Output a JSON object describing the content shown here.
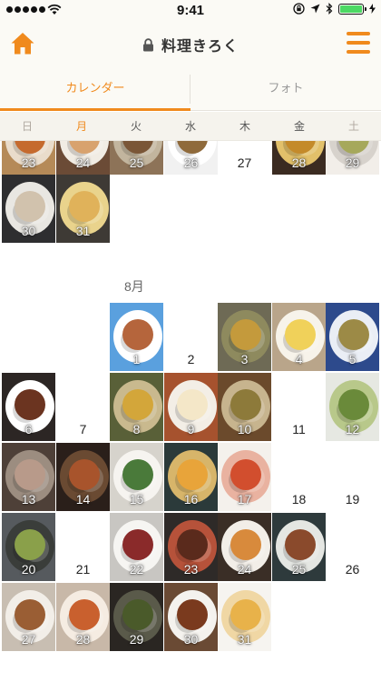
{
  "status_bar": {
    "time": "9:41"
  },
  "nav": {
    "title": "料理きろく"
  },
  "tabs": [
    {
      "label": "カレンダー",
      "active": true
    },
    {
      "label": "フォト",
      "active": false
    }
  ],
  "weekdays": [
    "日",
    "月",
    "火",
    "水",
    "木",
    "金",
    "土"
  ],
  "colors": {
    "accent": "#f08a1d",
    "background": "#fbfaf5",
    "battery": "#4cd964"
  },
  "calendar": {
    "prev_month_days": [
      {
        "day": "23",
        "photo": true,
        "bg": "#b58a58",
        "plate": "#e9dccb",
        "food": "#c56a2e"
      },
      {
        "day": "24",
        "photo": true,
        "bg": "#6b4b36",
        "plate": "#f1ece4",
        "food": "#d8a26e"
      },
      {
        "day": "25",
        "photo": true,
        "bg": "#8d7358",
        "plate": "#c2b59e",
        "food": "#7a5637"
      },
      {
        "day": "26",
        "photo": true,
        "bg": "#f1f1f1",
        "plate": "#ffffff",
        "food": "#8f6a3b"
      },
      {
        "day": "27",
        "photo": false
      },
      {
        "day": "28",
        "photo": true,
        "bg": "#3b2b21",
        "plate": "#e2c06a",
        "food": "#c48a2a"
      },
      {
        "day": "29",
        "photo": true,
        "bg": "#f2eee9",
        "plate": "#d7d2cc",
        "food": "#a6a85b"
      },
      {
        "day": "30",
        "photo": true,
        "bg": "#2e2e30",
        "plate": "#e9e7e2",
        "food": "#d1c2ad"
      },
      {
        "day": "31",
        "photo": true,
        "bg": "#3e3a35",
        "plate": "#e9d38c",
        "food": "#e0b25a"
      }
    ],
    "month_label": "8月",
    "aug_days": [
      {
        "day": "1",
        "photo": true,
        "bg": "#5aa0de",
        "plate": "#ffffff",
        "food": "#b5653c"
      },
      {
        "day": "2",
        "photo": false
      },
      {
        "day": "3",
        "photo": true,
        "bg": "#6e6a55",
        "plate": "#8e8a5e",
        "food": "#c49a3c"
      },
      {
        "day": "4",
        "photo": true,
        "bg": "#b9a58a",
        "plate": "#f7f3ea",
        "food": "#f0d15a"
      },
      {
        "day": "5",
        "photo": true,
        "bg": "#2d4a8c",
        "plate": "#eaeef5",
        "food": "#9c8a46"
      },
      {
        "day": "6",
        "photo": true,
        "bg": "#2c2624",
        "plate": "#ffffff",
        "food": "#6b3420"
      },
      {
        "day": "7",
        "photo": false
      },
      {
        "day": "8",
        "photo": true,
        "bg": "#596038",
        "plate": "#c9b98e",
        "food": "#d3a63a"
      },
      {
        "day": "9",
        "photo": true,
        "bg": "#a6522e",
        "plate": "#f3eee6",
        "food": "#f4e7c8"
      },
      {
        "day": "10",
        "photo": true,
        "bg": "#6b4a2c",
        "plate": "#c7b48e",
        "food": "#8d7a3a"
      },
      {
        "day": "11",
        "photo": false
      },
      {
        "day": "12",
        "photo": true,
        "bg": "#e6e8e2",
        "plate": "#b8c88a",
        "food": "#6a8a3a"
      },
      {
        "day": "13",
        "photo": true,
        "bg": "#4e4038",
        "plate": "#9c8d80",
        "food": "#b89a8a"
      },
      {
        "day": "14",
        "photo": true,
        "bg": "#2a1f1a",
        "plate": "#6a4a32",
        "food": "#a8542c"
      },
      {
        "day": "15",
        "photo": true,
        "bg": "#d6d3cc",
        "plate": "#f6f4f0",
        "food": "#4a7a3a"
      },
      {
        "day": "16",
        "photo": true,
        "bg": "#2b3a3a",
        "plate": "#d7b56a",
        "food": "#e8a43a"
      },
      {
        "day": "17",
        "photo": true,
        "bg": "#f4f1ec",
        "plate": "#e9b2a0",
        "food": "#d24e2e"
      },
      {
        "day": "18",
        "photo": false
      },
      {
        "day": "19",
        "photo": false
      },
      {
        "day": "20",
        "photo": true,
        "bg": "#565a5e",
        "plate": "#3a3d3a",
        "food": "#8aa04a"
      },
      {
        "day": "21",
        "photo": false
      },
      {
        "day": "22",
        "photo": true,
        "bg": "#c8c6c2",
        "plate": "#f6f5f2",
        "food": "#8a2a2a"
      },
      {
        "day": "23",
        "photo": true,
        "bg": "#2e2a28",
        "plate": "#b6523a",
        "food": "#5a2a1c"
      },
      {
        "day": "24",
        "photo": true,
        "bg": "#3a2e26",
        "plate": "#f2eee8",
        "food": "#d88a3c"
      },
      {
        "day": "25",
        "photo": true,
        "bg": "#2e3a3c",
        "plate": "#e4e6e2",
        "food": "#8a4a2c"
      },
      {
        "day": "26",
        "photo": false
      },
      {
        "day": "27",
        "photo": true,
        "bg": "#c8beb2",
        "plate": "#f2eee8",
        "food": "#9a5e34"
      },
      {
        "day": "28",
        "photo": true,
        "bg": "#c8b8a8",
        "plate": "#f5ece2",
        "food": "#c9602e"
      },
      {
        "day": "29",
        "photo": true,
        "bg": "#2a2622",
        "plate": "#5a5a4a",
        "food": "#4a5a2a"
      },
      {
        "day": "30",
        "photo": true,
        "bg": "#6a4a34",
        "plate": "#f4f2ee",
        "food": "#7a3a1e"
      },
      {
        "day": "31",
        "photo": true,
        "bg": "#f6f4f0",
        "plate": "#f0d7a4",
        "food": "#e8b24a"
      }
    ]
  }
}
